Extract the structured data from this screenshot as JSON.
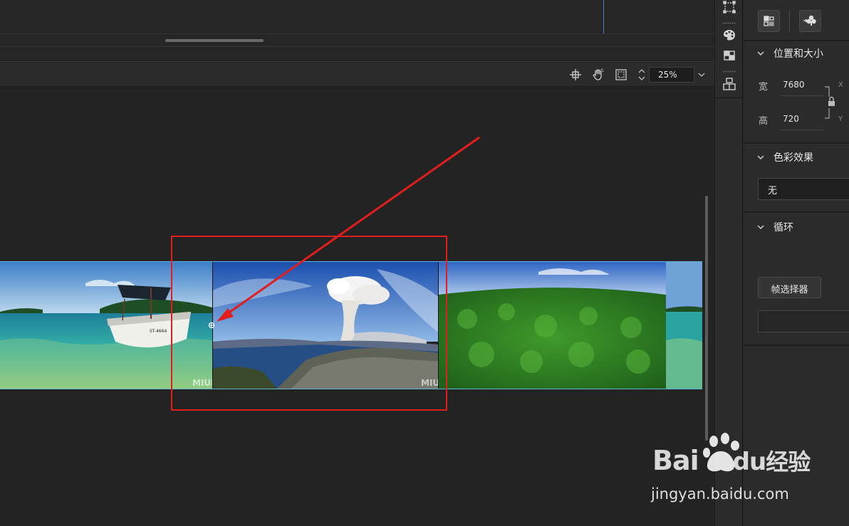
{
  "toolbar": {
    "zoom_value": "25%",
    "icons": [
      "crosshair-icon",
      "hand-icon",
      "fit-frame-icon",
      "zoom-stepper-icon",
      "chevron-down-icon"
    ]
  },
  "image_strip": {
    "frames": [
      {
        "scene": "boat on clear turquoise water",
        "boat_text": "ST-4664",
        "mark": "MIUI"
      },
      {
        "scene": "volcano eruption over coastal city",
        "mark": "MIUI"
      },
      {
        "scene": "green forest under blue sky"
      },
      {
        "scene": "partial coastline"
      }
    ]
  },
  "icon_column": {
    "icons": [
      "selection-icon",
      "palette-icon",
      "transform-icon",
      "layers-icon"
    ]
  },
  "properties": {
    "buttons": [
      "align-icon",
      "effects-icon"
    ],
    "position_size": {
      "title": "位置和大小",
      "width_label": "宽",
      "width_value": "7680",
      "x_label": "X",
      "height_label": "高",
      "height_value": "720",
      "y_label": "Y"
    },
    "color_effect": {
      "title": "色彩效果",
      "selected": "无"
    },
    "loop": {
      "title": "循环",
      "frame_selector_label": "帧选择器"
    }
  },
  "watermark": {
    "main_left": "Bai",
    "main_mid": "du",
    "main_right": "经验",
    "sub": "jingyan.baidu.com"
  },
  "colors": {
    "annotation": "#e21d1d",
    "strip_border": "#5fb6d6",
    "playhead": "#4a7fd0"
  }
}
